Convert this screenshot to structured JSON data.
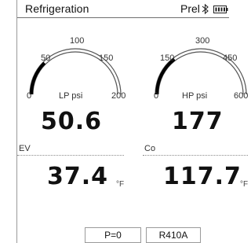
{
  "header": {
    "title": "Refrigeration",
    "mode": "Prel",
    "bluetooth_icon": "bluetooth-icon",
    "battery_icon": "battery-icon"
  },
  "gauges": {
    "lp": {
      "unit": "LP psi",
      "ticks": [
        "0",
        "50",
        "100",
        "150",
        "200"
      ],
      "value": "50.6",
      "value_number": 50.6,
      "scale_max": 200
    },
    "hp": {
      "unit": "HP psi",
      "ticks": [
        "0",
        "150",
        "300",
        "450",
        "600"
      ],
      "value": "177",
      "value_number": 177,
      "scale_max": 600
    }
  },
  "readings": {
    "ev": {
      "label": "EV",
      "value": "37.4",
      "unit": "°F"
    },
    "co": {
      "label": "Co",
      "value": "117.7",
      "unit": "°F"
    }
  },
  "footer": {
    "pressure_button": "P=0",
    "refrigerant_button": "R410A"
  },
  "colors": {
    "arc": "#555555",
    "fill": "#000000"
  }
}
